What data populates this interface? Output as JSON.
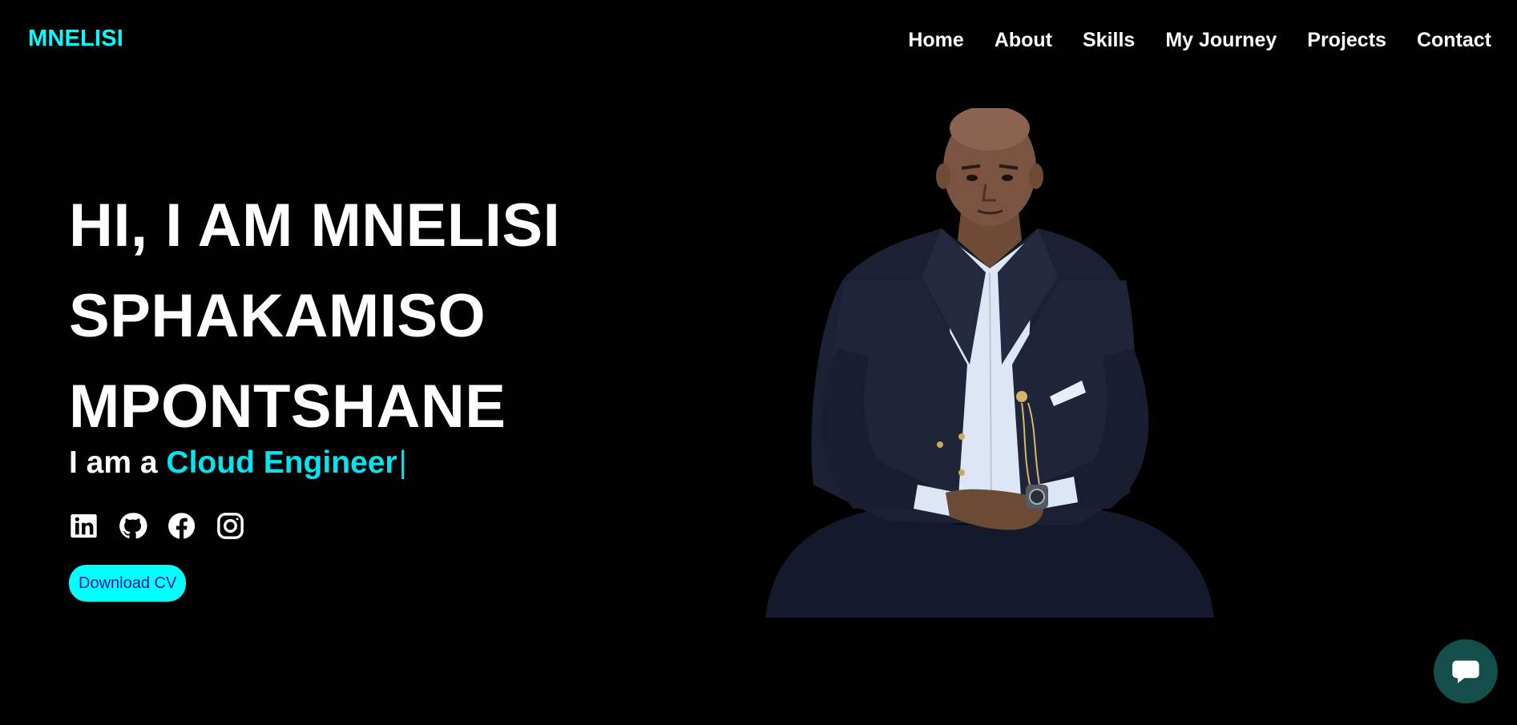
{
  "nav": {
    "logo": "MNELISI",
    "links": [
      "Home",
      "About",
      "Skills",
      "My Journey",
      "Projects",
      "Contact"
    ]
  },
  "hero": {
    "title_lines": [
      "HI, I AM MNELISI",
      "SPHAKAMISO",
      "MPONTSHANE"
    ],
    "subtitle_prefix": "I am a ",
    "subtitle_role": "Cloud Engineer",
    "caret": "|",
    "socials": [
      "linkedin-icon",
      "github-icon",
      "facebook-icon",
      "instagram-icon"
    ],
    "download_label": "Download CV"
  },
  "colors": {
    "background": "#000000",
    "accent": "#00ffff",
    "role_text": "#00e5ee",
    "button_text": "#1a1aa8",
    "chat_bubble": "#134e4a"
  },
  "chat": {
    "icon": "chat-bubble-icon"
  }
}
